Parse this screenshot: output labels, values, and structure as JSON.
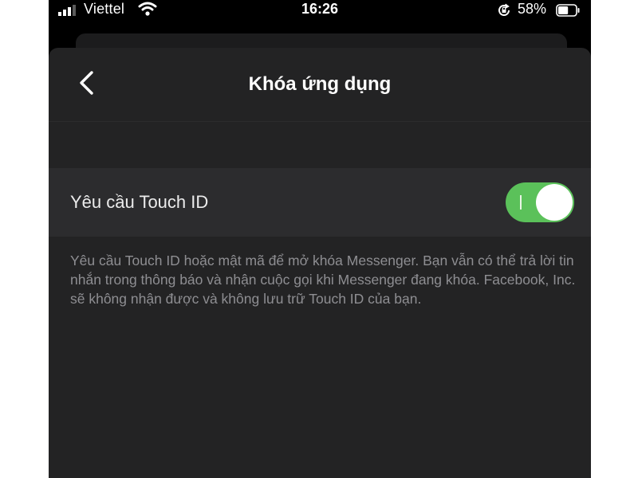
{
  "status_bar": {
    "carrier": "Viettel",
    "time": "16:26",
    "battery_percent": "58%",
    "battery_level": 0.58,
    "icons": [
      "signal-icon",
      "wifi-icon",
      "rotation-lock-icon",
      "battery-icon"
    ]
  },
  "nav": {
    "title": "Khóa ứng dụng",
    "back_icon": "chevron-left-icon"
  },
  "settings": {
    "touch_id_row": {
      "label": "Yêu cầu Touch ID",
      "enabled": true
    },
    "description": "Yêu cầu Touch ID hoặc mật mã để mở khóa Messenger. Bạn vẫn có thể trả lời tin nhắn trong thông báo và nhận cuộc gọi khi Messenger đang khóa. Facebook, Inc. sẽ không nhận được và không lưu trữ Touch ID của bạn."
  },
  "colors": {
    "background": "#000000",
    "sheet": "#232324",
    "row": "#2c2c2e",
    "toggle_on": "#5bc15a",
    "secondary_text": "#8e8e92"
  }
}
